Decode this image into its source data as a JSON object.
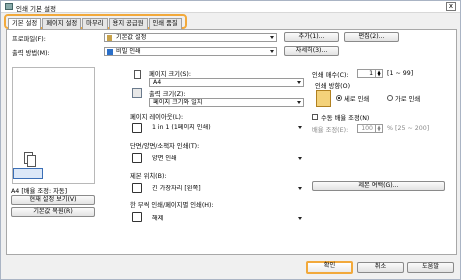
{
  "window": {
    "title": "인쇄 기본 설정",
    "close_label": "x"
  },
  "tabs": [
    "기본 설정",
    "페이지 설정",
    "마무리",
    "용지 공급원",
    "인쇄 품질"
  ],
  "profile": {
    "label": "프로파일(F):",
    "value": "기본값 설정",
    "add_label": "추가(1)...",
    "edit_label": "편집(2)..."
  },
  "output": {
    "label": "출력 방법(M):",
    "value": "비밀 인쇄",
    "details_label": "자세히(3)..."
  },
  "preview": {
    "caption": "A4 [배율 조정: 자동]",
    "view_settings_label": "현재 설정 보기(V)",
    "restore_defaults_label": "기본값 복원(R)"
  },
  "page_size": {
    "label": "페이지 크기(S):",
    "value": "A4"
  },
  "output_size": {
    "label": "출력 크기(Z):",
    "value": "페이지 크기와 일치"
  },
  "layout": {
    "label": "페이지 레이아웃(L):",
    "value": "1 in 1 (1페이지 인쇄)"
  },
  "duplex": {
    "label": "단면/양면/소책자 인쇄(T):",
    "value": "양면 인쇄"
  },
  "binding": {
    "label": "제본 위치(B):",
    "value": "긴 가장자리 [왼쪽]",
    "margin_label": "제본 여백(G)..."
  },
  "multi_booklet": {
    "label": "한 부씩 인쇄/페이지별 인쇄(H):",
    "value": "해제"
  },
  "copies": {
    "label": "인쇄 매수(C):",
    "value": "1",
    "range": "[1 ~ 99]"
  },
  "orientation": {
    "label": "인쇄 방향(O)",
    "portrait_label": "세로 인쇄",
    "landscape_label": "가로 인쇄"
  },
  "manual_scaling": {
    "label": "수동 배율 조정(N)",
    "scale_label": "배율 조정(E):",
    "value": "100",
    "range": "% [25 ~ 200]"
  },
  "footer": {
    "ok_label": "확인",
    "cancel_label": "취소",
    "help_label": "도움말"
  },
  "colors": {
    "highlight": "#f2a93b",
    "output_icon": "#2a6fc9"
  }
}
